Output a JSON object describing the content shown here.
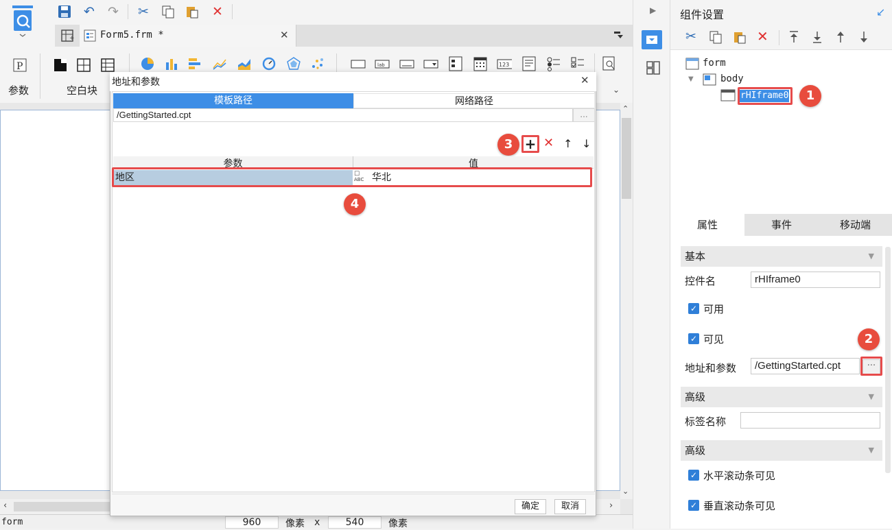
{
  "toolbar": {
    "param_label": "参数",
    "blank_block_label": "空白块"
  },
  "tab": {
    "title": "Form5.frm *",
    "close": "✕"
  },
  "status": {
    "left_text": "form",
    "width_value": "960",
    "width_unit": "像素",
    "times": "x",
    "height_value": "540",
    "height_unit": "像素"
  },
  "right_panel": {
    "title": "组件设置",
    "tree": {
      "root": "form",
      "body": "body",
      "component": "rHIframe0"
    },
    "tabs": [
      "属性",
      "事件",
      "移动端"
    ],
    "sections": {
      "basic": "基本",
      "advanced1": "高级",
      "advanced2": "高级"
    },
    "fields": {
      "control_name_label": "控件名",
      "control_name_value": "rHIframe0",
      "enabled_label": "可用",
      "visible_label": "可见",
      "url_label": "地址和参数",
      "url_value": "/GettingStarted.cpt",
      "url_button": "···",
      "tag_label": "标签名称",
      "tag_value": "",
      "hscroll_label": "水平滚动条可见",
      "vscroll_label": "垂直滚动条可见"
    }
  },
  "dialog": {
    "title": "地址和参数",
    "close": "✕",
    "path_tabs": [
      "模板路径",
      "网络路径"
    ],
    "path_value": "/GettingStarted.cpt",
    "path_button": "...",
    "table": {
      "headers": [
        "参数",
        "值"
      ],
      "rows": [
        {
          "name": "地区",
          "type": "ABC",
          "value": "华北"
        }
      ]
    },
    "ok": "确定",
    "cancel": "取消"
  },
  "annotations": [
    "1",
    "2",
    "3",
    "4"
  ],
  "colors": {
    "accent_blue": "#3d8ee6",
    "annotation_red": "#e84c3d",
    "selection_blue": "#b7cde0"
  }
}
